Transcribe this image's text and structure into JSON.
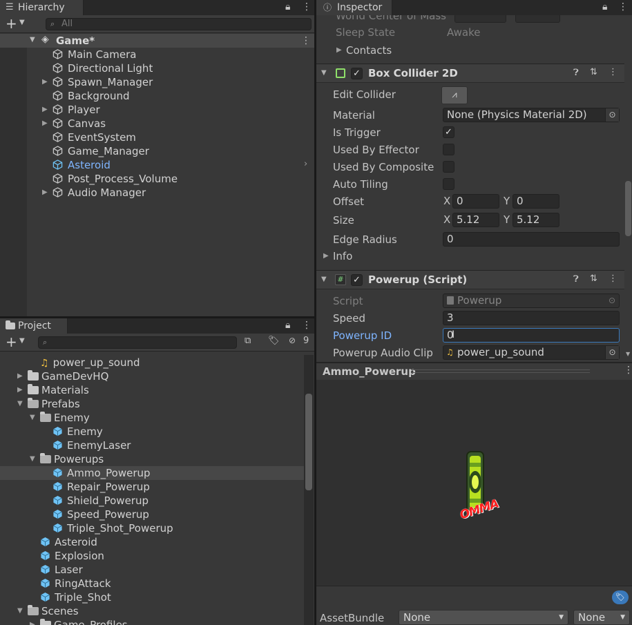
{
  "hierarchy": {
    "tab_label": "Hierarchy",
    "search_placeholder": "All",
    "scene_name": "Game*",
    "items": [
      {
        "label": "Main Camera",
        "expandable": false,
        "selected": false
      },
      {
        "label": "Directional Light",
        "expandable": false,
        "selected": false
      },
      {
        "label": "Spawn_Manager",
        "expandable": true,
        "selected": false
      },
      {
        "label": "Background",
        "expandable": false,
        "selected": false
      },
      {
        "label": "Player",
        "expandable": true,
        "selected": false
      },
      {
        "label": "Canvas",
        "expandable": true,
        "selected": false
      },
      {
        "label": "EventSystem",
        "expandable": false,
        "selected": false
      },
      {
        "label": "Game_Manager",
        "expandable": false,
        "selected": false
      },
      {
        "label": "Asteroid",
        "expandable": false,
        "selected": false
      },
      {
        "label": "Post_Process_Volume",
        "expandable": false,
        "selected": false
      },
      {
        "label": "Audio Manager",
        "expandable": true,
        "selected": false
      }
    ]
  },
  "project": {
    "tab_label": "Project",
    "hidden_count": "9",
    "items": [
      {
        "label": "power_up_sound",
        "type": "audio",
        "indent": 1
      },
      {
        "label": "GameDevHQ",
        "type": "folder",
        "indent": 0
      },
      {
        "label": "Materials",
        "type": "folder",
        "indent": 0
      },
      {
        "label": "Prefabs",
        "type": "folder-open",
        "indent": 0
      },
      {
        "label": "Enemy",
        "type": "folder-open",
        "indent": 1
      },
      {
        "label": "Enemy",
        "type": "prefab",
        "indent": 2
      },
      {
        "label": "EnemyLaser",
        "type": "prefab",
        "indent": 2
      },
      {
        "label": "Powerups",
        "type": "folder-open",
        "indent": 1
      },
      {
        "label": "Ammo_Powerup",
        "type": "prefab",
        "indent": 2
      },
      {
        "label": "Repair_Powerup",
        "type": "prefab",
        "indent": 2
      },
      {
        "label": "Shield_Powerup",
        "type": "prefab",
        "indent": 2
      },
      {
        "label": "Speed_Powerup",
        "type": "prefab",
        "indent": 2
      },
      {
        "label": "Triple_Shot_Powerup",
        "type": "prefab",
        "indent": 2
      },
      {
        "label": "Asteroid",
        "type": "prefab",
        "indent": 1
      },
      {
        "label": "Explosion",
        "type": "prefab",
        "indent": 1
      },
      {
        "label": "Laser",
        "type": "prefab",
        "indent": 1
      },
      {
        "label": "RingAttack",
        "type": "prefab",
        "indent": 1
      },
      {
        "label": "Triple_Shot",
        "type": "prefab",
        "indent": 1
      },
      {
        "label": "Scenes",
        "type": "folder-open",
        "indent": 0
      },
      {
        "label": "Game_Profiles",
        "type": "folder",
        "indent": 1
      }
    ]
  },
  "inspector": {
    "tab_label": "Inspector",
    "rigidbody": {
      "world_center_label": "World Center of Mass",
      "sleep_state_label": "Sleep State",
      "sleep_state_value": "Awake",
      "contacts_label": "Contacts"
    },
    "box_collider": {
      "title": "Box Collider 2D",
      "enabled": true,
      "edit_collider_label": "Edit Collider",
      "material_label": "Material",
      "material_value": "None (Physics Material 2D)",
      "is_trigger_label": "Is Trigger",
      "is_trigger": true,
      "used_by_effector_label": "Used By Effector",
      "used_by_composite_label": "Used By Composite",
      "auto_tiling_label": "Auto Tiling",
      "offset_label": "Offset",
      "offset_x": "0",
      "offset_y": "0",
      "size_label": "Size",
      "size_x": "5.12",
      "size_y": "5.12",
      "edge_radius_label": "Edge Radius",
      "edge_radius_value": "0",
      "info_label": "Info",
      "x_label": "X",
      "y_label": "Y"
    },
    "powerup_script": {
      "title": "Powerup (Script)",
      "enabled": true,
      "script_label": "Script",
      "script_value": "Powerup",
      "speed_label": "Speed",
      "speed_value": "3",
      "powerup_id_label": "Powerup ID",
      "powerup_id_value": "0",
      "audio_clip_label": "Powerup Audio Clip",
      "audio_clip_value": "power_up_sound"
    },
    "preview": {
      "title": "Ammo_Powerup",
      "sprite_text": "OMMA"
    },
    "asset_bundle": {
      "label": "AssetBundle",
      "bundle_value": "None",
      "variant_value": "None"
    }
  },
  "colors": {
    "selection_blue": "#7fb5ff",
    "prefab_blue": "#6fc3f5",
    "focus_blue": "#3a79bb"
  }
}
